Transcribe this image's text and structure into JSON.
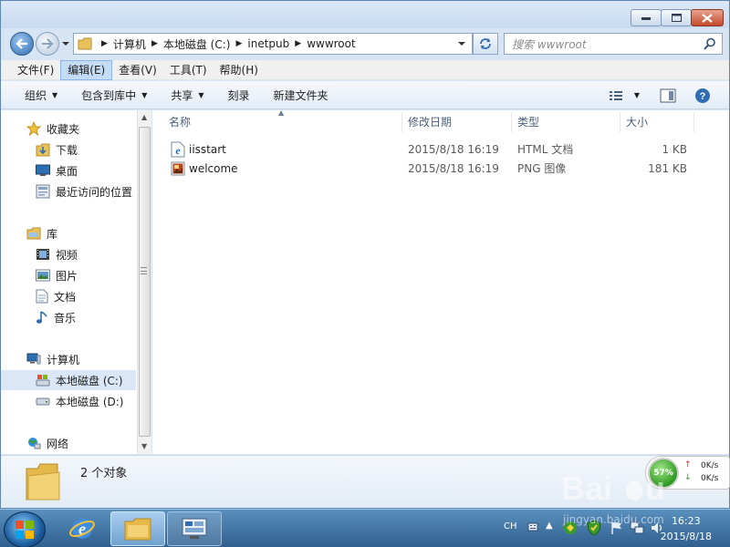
{
  "address": {
    "crumbs": [
      "计算机",
      "本地磁盘 (C:)",
      "inetpub",
      "wwwroot"
    ]
  },
  "search": {
    "placeholder": "搜索 wwwroot"
  },
  "menubar": {
    "items": [
      "文件(F)",
      "编辑(E)",
      "查看(V)",
      "工具(T)",
      "帮助(H)"
    ]
  },
  "toolbar": {
    "organize": "组织",
    "include_in_library": "包含到库中",
    "share": "共享",
    "burn": "刻录",
    "new_folder": "新建文件夹"
  },
  "navpane": {
    "favorites": "收藏夹",
    "downloads": "下载",
    "desktop": "桌面",
    "recent": "最近访问的位置",
    "libraries": "库",
    "videos": "视频",
    "pictures": "图片",
    "documents": "文档",
    "music": "音乐",
    "computer": "计算机",
    "drive_c": "本地磁盘 (C:)",
    "drive_d": "本地磁盘 (D:)",
    "network": "网络"
  },
  "columns": {
    "name": "名称",
    "modified": "修改日期",
    "type": "类型",
    "size": "大小"
  },
  "files": [
    {
      "name": "iisstart",
      "modified": "2015/8/18 16:19",
      "type": "HTML 文档",
      "size": "1 KB"
    },
    {
      "name": "welcome",
      "modified": "2015/8/18 16:19",
      "type": "PNG 图像",
      "size": "181 KB"
    }
  ],
  "details": {
    "count": "2 个对象"
  },
  "netwidget": {
    "percent": "57%",
    "up": "0K/s",
    "down": "0K/s"
  },
  "tray": {
    "lang": "CH"
  },
  "clock": {
    "time": "16:23",
    "date": "2015/8/18"
  },
  "watermark": {
    "text": "jingyan.baidu.com"
  },
  "colors": {
    "selection": "#d9e7f6",
    "menu_active": "#c5dcf6",
    "taskbar": "#2f5f8e"
  }
}
